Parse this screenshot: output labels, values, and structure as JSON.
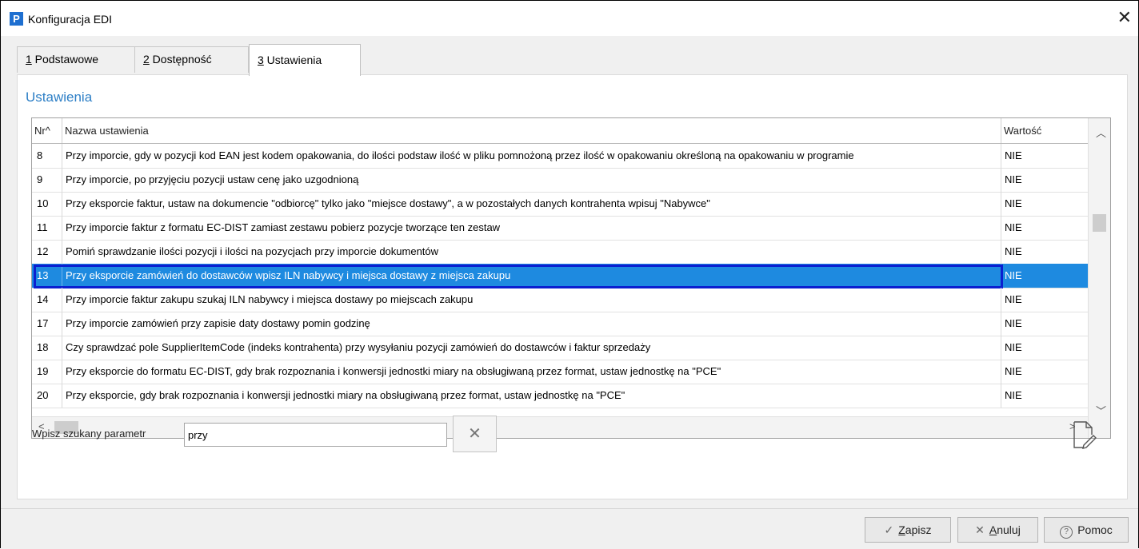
{
  "window": {
    "app_icon_letter": "P",
    "title": "Konfiguracja EDI",
    "close_glyph": "✕"
  },
  "tabs": [
    {
      "key": "1",
      "label": " Podstawowe"
    },
    {
      "key": "2",
      "label": " Dostępność"
    },
    {
      "key": "3",
      "label": " Ustawienia"
    }
  ],
  "section_title": "Ustawienia",
  "table": {
    "headers": {
      "nr": "Nr^",
      "name": "Nazwa ustawienia",
      "value": "Wartość"
    },
    "rows": [
      {
        "nr": "8",
        "name": "Przy imporcie, gdy w pozycji kod EAN jest kodem opakowania, do ilości podstaw ilość w pliku pomnożoną przez ilość w opakowaniu określoną na opakowaniu w programie",
        "value": "NIE"
      },
      {
        "nr": "9",
        "name": "Przy imporcie, po przyjęciu pozycji ustaw cenę jako uzgodnioną",
        "value": "NIE"
      },
      {
        "nr": "10",
        "name": "Przy eksporcie faktur, ustaw na dokumencie \"odbiorcę\" tylko jako \"miejsce dostawy\", a w pozostałych danych kontrahenta wpisuj \"Nabywce\"",
        "value": "NIE"
      },
      {
        "nr": "11",
        "name": "Przy imporcie faktur z formatu EC-DIST zamiast zestawu pobierz pozycje tworzące ten zestaw",
        "value": "NIE"
      },
      {
        "nr": "12",
        "name": "Pomiń sprawdzanie ilości pozycji i ilości na pozycjach przy imporcie dokumentów",
        "value": "NIE"
      },
      {
        "nr": "13",
        "name": "Przy eksporcie zamówień do dostawców wpisz ILN nabywcy i miejsca dostawy z miejsca zakupu",
        "value": "NIE"
      },
      {
        "nr": "14",
        "name": "Przy imporcie faktur zakupu szukaj ILN nabywcy i miejsca dostawy po miejscach zakupu",
        "value": "NIE"
      },
      {
        "nr": "17",
        "name": "Przy imporcie zamówień przy zapisie daty dostawy pomin godzinę",
        "value": "NIE"
      },
      {
        "nr": "18",
        "name": "Czy sprawdzać pole SupplierItemCode (indeks kontrahenta) przy wysyłaniu pozycji zamówień do dostawców i faktur sprzedaży",
        "value": "NIE"
      },
      {
        "nr": "19",
        "name": "Przy eksporcie do formatu EC-DIST, gdy brak rozpoznania i konwersji jednostki miary na obsługiwaną przez format, ustaw jednostkę na \"PCE\"",
        "value": "NIE"
      },
      {
        "nr": "20",
        "name": "Przy eksporcie, gdy brak rozpoznania i konwersji jednostki miary na obsługiwaną przez format, ustaw jednostkę na \"PCE\"",
        "value": "NIE"
      }
    ],
    "selected_nr": "13"
  },
  "search": {
    "label": "Wpisz szukany parametr",
    "value": "przy",
    "clear_glyph": "✕"
  },
  "buttons": {
    "save": {
      "icon": "✓",
      "key": "Z",
      "rest": "apisz"
    },
    "cancel": {
      "icon": "✕",
      "key": "A",
      "rest": "nuluj"
    },
    "help": {
      "icon": "?",
      "label": "Pomoc"
    }
  },
  "icons": {
    "app": "app-logo-icon",
    "close": "close-icon",
    "clear": "clear-icon",
    "edit": "edit-document-icon",
    "check": "check-icon",
    "x": "x-icon",
    "help": "help-circle-icon"
  },
  "colors": {
    "accent": "#2d7fc6",
    "selection": "#1e8ae0",
    "selection_outline": "#0b1fd0",
    "app_icon": "#1e6fd0"
  }
}
